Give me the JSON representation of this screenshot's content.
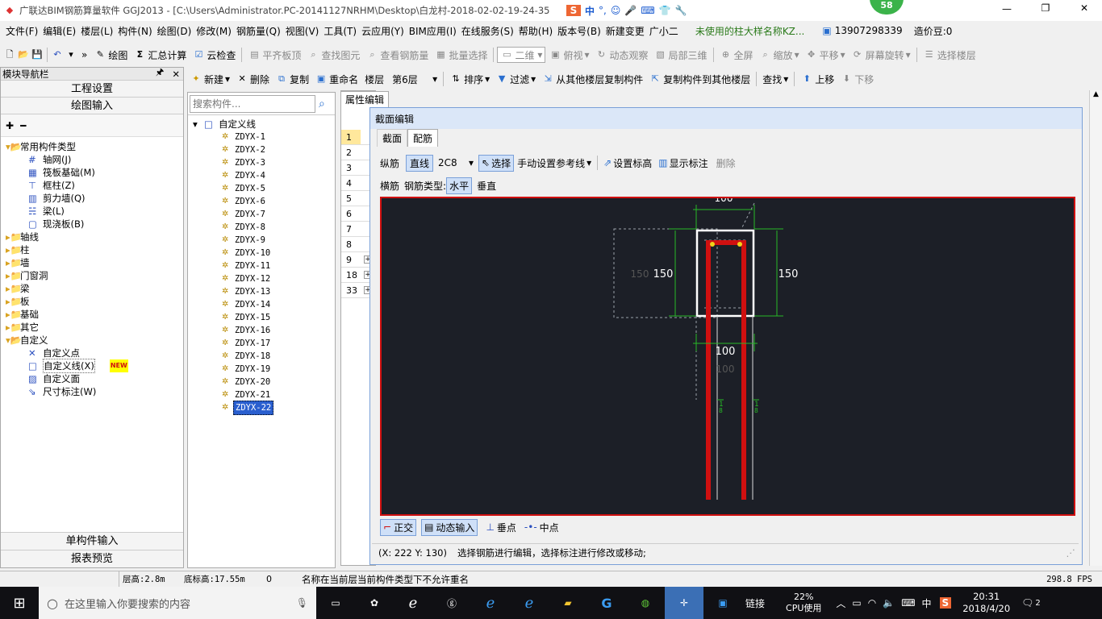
{
  "window": {
    "title": "广联达BIM钢筋算量软件 GGJ2013 - [C:\\Users\\Administrator.PC-20141127NRHM\\Desktop\\白龙村-2018-02-02-19-24-35",
    "badge": "58",
    "ime_label": "中"
  },
  "menu": [
    "文件(F)",
    "编辑(E)",
    "楼层(L)",
    "构件(N)",
    "绘图(D)",
    "修改(M)",
    "钢筋量(Q)",
    "视图(V)",
    "工具(T)",
    "云应用(Y)",
    "BIM应用(I)",
    "在线服务(S)",
    "帮助(H)",
    "版本号(B)",
    "新建变更",
    "广小二"
  ],
  "menu_notice": "未使用的柱大样名称KZ...",
  "account": {
    "phone": "13907298339",
    "coins": "造价豆:0"
  },
  "toolbar1": {
    "draw": "绘图",
    "sum": "汇总计算",
    "cloud": "云检查",
    "align": "平齐板顶",
    "find": "查找图元",
    "view_qty": "查看钢筋量",
    "batch": "批量选择",
    "dim": "二维",
    "top": "俯视",
    "dynamic": "动态观察",
    "local3d": "局部三维",
    "full": "全屏",
    "zoom": "缩放",
    "pan": "平移",
    "rotate": "屏幕旋转",
    "select_floor": "选择楼层"
  },
  "toolbar2": {
    "new": "新建",
    "delete": "删除",
    "copy": "复制",
    "rename": "重命名",
    "floor_label": "楼层",
    "floor": "第6层",
    "sort": "排序",
    "filter": "过滤",
    "copy_from": "从其他楼层复制构件",
    "copy_to": "复制构件到其他楼层",
    "find": "查找",
    "up": "上移",
    "down": "下移"
  },
  "nav": {
    "title": "模块导航栏",
    "settings": "工程设置",
    "draw_input": "绘图输入",
    "single": "单构件输入",
    "report": "报表预览",
    "tree": {
      "common": "常用构件类型",
      "common_items": [
        "轴网(J)",
        "筏板基础(M)",
        "框柱(Z)",
        "剪力墙(Q)",
        "梁(L)",
        "现浇板(B)"
      ],
      "groups": [
        "轴线",
        "柱",
        "墙",
        "门窗洞",
        "梁",
        "板",
        "基础",
        "其它"
      ],
      "custom": "自定义",
      "custom_items": [
        "自定义点",
        "自定义线(X)",
        "自定义面",
        "尺寸标注(W)"
      ],
      "new_tag": "NEW"
    }
  },
  "list": {
    "search_placeholder": "搜索构件...",
    "root": "自定义线",
    "items": [
      "ZDYX-1",
      "ZDYX-2",
      "ZDYX-3",
      "ZDYX-4",
      "ZDYX-5",
      "ZDYX-6",
      "ZDYX-7",
      "ZDYX-8",
      "ZDYX-9",
      "ZDYX-10",
      "ZDYX-11",
      "ZDYX-12",
      "ZDYX-13",
      "ZDYX-14",
      "ZDYX-15",
      "ZDYX-16",
      "ZDYX-17",
      "ZDYX-18",
      "ZDYX-19",
      "ZDYX-20",
      "ZDYX-21",
      "ZDYX-22"
    ]
  },
  "prop": {
    "tab": "属性编辑",
    "rows": [
      "1",
      "2",
      "3",
      "4",
      "5",
      "6",
      "7",
      "8",
      "9",
      "18",
      "33"
    ]
  },
  "section": {
    "title": "截面编辑",
    "tabs": [
      "截面",
      "配筋"
    ],
    "row1": {
      "long": "纵筋",
      "line": "直线",
      "bar": "2C8",
      "select": "选择",
      "manual": "手动设置参考线",
      "elev": "设置标高",
      "show": "显示标注",
      "del": "删除"
    },
    "row2": {
      "trans": "横筋",
      "type_label": "钢筋类型:",
      "h": "水平",
      "v": "垂直"
    },
    "dims": {
      "top": "100",
      "left_ghost": "150",
      "left": "150",
      "right": "150",
      "bottom": "100",
      "bottom_ghost": "100"
    },
    "snap": {
      "ortho": "正交",
      "dyn": "动态输入",
      "perp": "垂点",
      "mid": "中点"
    },
    "status": {
      "coord": "(X: 222 Y: 130)",
      "hint": "选择钢筋进行编辑，选择标注进行修改或移动;"
    }
  },
  "statusbar": {
    "floor_h": "层高:2.8m",
    "base_h": "底标高:17.55m",
    "zero": "0",
    "msg": "名称在当前层当前构件类型下不允许重名",
    "fps": "298.8 FPS"
  },
  "taskbar": {
    "search": "在这里输入你要搜索的内容",
    "link": "链接",
    "cpu_pct": "22%",
    "cpu_label": "CPU使用",
    "ime": "中",
    "time": "20:31",
    "date": "2018/4/20",
    "notif": "2"
  },
  "colors": {
    "accent": "#2a6fcf",
    "canvas": "#1c1f27",
    "rebar": "#d01010",
    "dim": "#27b827"
  }
}
